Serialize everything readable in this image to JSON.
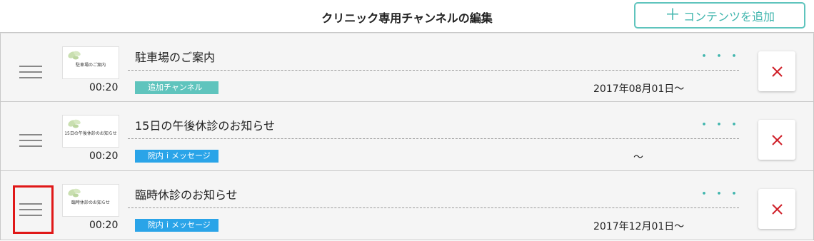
{
  "header": {
    "title": "クリニック専用チャンネルの編集",
    "add_button_label": "コンテンツを追加",
    "add_icon": "plus-icon",
    "accent_color": "#3fb5ad"
  },
  "rows": [
    {
      "thumbnail_text": "駐車場のご案内",
      "duration": "00:20",
      "title": "駐車場のご案内",
      "tag": "追加チャンネル",
      "tag_color": "#5fc4bd",
      "date": "2017年08月01日〜",
      "more": "・・・"
    },
    {
      "thumbnail_text": "15日の午後休診のお知らせ",
      "duration": "00:20",
      "title": "15日の午後休診のお知らせ",
      "tag": "院内ｉメッセージ",
      "tag_color": "#2aa4e8",
      "date": "〜",
      "more": "・・・"
    },
    {
      "thumbnail_text": "臨時休診のお知らせ",
      "duration": "00:20",
      "title": "臨時休診のお知らせ",
      "tag": "院内ｉメッセージ",
      "tag_color": "#2aa4e8",
      "date": "2017年12月01日〜",
      "more": "・・・"
    }
  ],
  "delete_color": "#d0212a",
  "highlight_color": "#e01818"
}
